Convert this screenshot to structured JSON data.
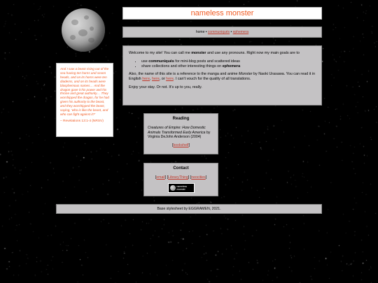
{
  "site": {
    "title": "nameless monster"
  },
  "nav": {
    "home": "home",
    "sep": "•",
    "communiques": "communiqués",
    "ephemera": "ephemera"
  },
  "quote": {
    "text": "And I saw a beast rising out of the sea having ten horns and seven heads, and on its horns were ten diadems, and on its heads were blasphemous names… And the dragon gave it his power and his throne and great authority… They worshipped the dragon, for he had given his authority to the beast, and they worshipped the beast, saying, 'who is like the beast, and who can fight against it?'",
    "cite": "– Revelations 13:1-4 (NRSV)"
  },
  "welcome": {
    "intro_pre": "Welcome to my site! You can call me",
    "intro_name": "monster",
    "intro_post": "and use any pronouns. Right now my main goals are to",
    "goal1_pre": "use",
    "goal1_strong": "communiqués",
    "goal1_post": "for mini-blog posts and scattered ideas",
    "goal2_pre": "share collections and other interesting things on",
    "goal2_strong": "ephemera",
    "ref_pre": "Also, the name of this site is a reference to the manga and anime",
    "ref_title": "Monster",
    "ref_mid": "by Naoki Urasawa. You can read it in English",
    "link1": "here",
    "link2": "here",
    "link3": "here",
    "ref_post": ". I can't vouch for the quality of all translations.",
    "enjoy": "Enjoy your stay. Or not. It's up to you, really."
  },
  "reading": {
    "heading": "Reading",
    "book_title": "Creatures of Empire: How Domestic Animals Transformed Early America",
    "book_by": "by Virginia DeJohn Anderson (2004)",
    "bookshelf": "bookshelf"
  },
  "contact": {
    "heading": "Contact",
    "email": "email",
    "librarything": "LibraryThing",
    "neocities": "neocities",
    "badge": "nameless monster"
  },
  "footer": {
    "text": "Base stylesheet by EGGRAMEN, 2021."
  },
  "colors": {
    "accent": "#f05a22",
    "panel": "#c4c2c4",
    "link": "#c0392b",
    "background": "#000000"
  }
}
